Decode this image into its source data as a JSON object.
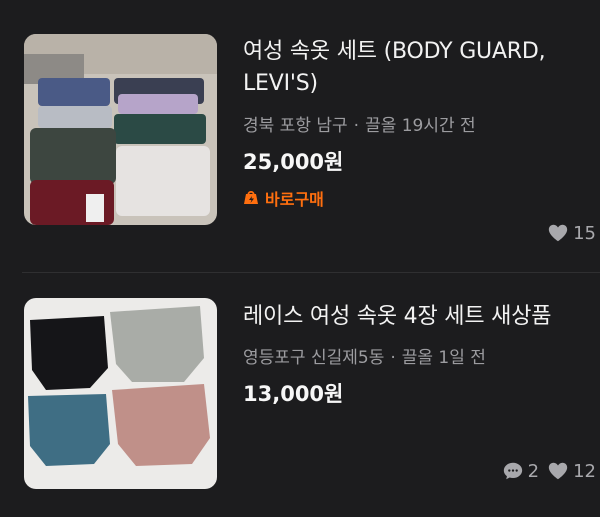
{
  "listings": [
    {
      "title": "여성 속옷 세트 (BODY GUARD, LEVI'S)",
      "location": "경북 포항 남구",
      "time": "끌올 19시간 전",
      "price": "25,000원",
      "badge": "바로구매",
      "likes": "15",
      "image_icon": "product-photo"
    },
    {
      "title": "레이스 여성 속옷 4장 세트 새상품",
      "location": "영등포구 신길제5동",
      "time": "끌올 1일 전",
      "price": "13,000원",
      "comments": "2",
      "likes": "12",
      "image_icon": "product-photo"
    }
  ],
  "meta_separator": "·",
  "colors": {
    "background": "#1c1c1e",
    "accent": "#ff6f0f",
    "secondary_text": "#9c9ca0"
  }
}
